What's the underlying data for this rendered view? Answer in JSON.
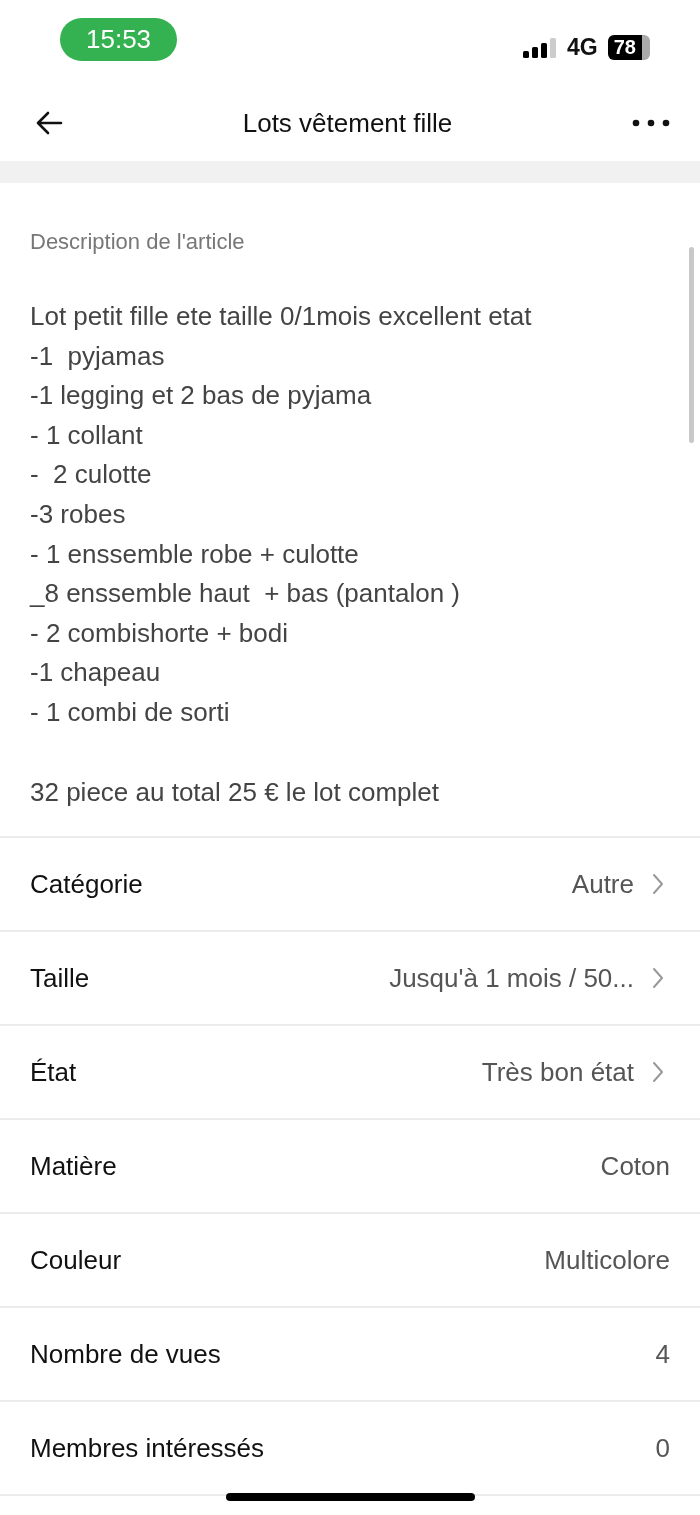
{
  "status_bar": {
    "time": "15:53",
    "network": "4G",
    "battery": "78"
  },
  "nav": {
    "title": "Lots vêtement fille"
  },
  "description": {
    "label": "Description de l'article",
    "lines": [
      "Lot petit fille ete taille 0/1mois excellent etat",
      "-1  pyjamas",
      "-1 legging et 2 bas de pyjama",
      "- 1 collant",
      "-  2 culotte",
      "-3 robes",
      "- 1 enssemble robe + culotte",
      "_8 enssemble haut  + bas (pantalon )",
      "- 2 combishorte + bodi",
      "-1 chapeau",
      "- 1 combi de sorti"
    ],
    "total": "32 piece au total 25 € le lot complet"
  },
  "details": [
    {
      "kind": "link",
      "label": "Catégorie",
      "value": "Autre"
    },
    {
      "kind": "link",
      "label": "Taille",
      "value": "Jusqu'à 1 mois / 50..."
    },
    {
      "kind": "link",
      "label": "État",
      "value": "Très bon état"
    },
    {
      "kind": "plain",
      "label": "Matière",
      "value": "Coton"
    },
    {
      "kind": "plain",
      "label": "Couleur",
      "value": "Multicolore"
    },
    {
      "kind": "plain",
      "label": "Nombre de vues",
      "value": "4"
    },
    {
      "kind": "plain",
      "label": "Membres intéressés",
      "value": "0"
    }
  ]
}
